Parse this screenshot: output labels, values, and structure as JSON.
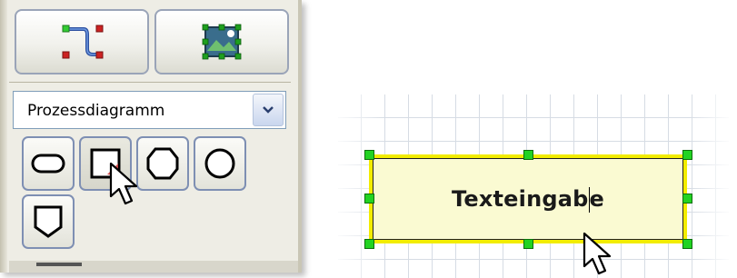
{
  "toolbar": {
    "buttons": [
      {
        "name": "connector-tool",
        "icon": "connector-curve-icon"
      },
      {
        "name": "image-tool",
        "icon": "image-frame-icon"
      }
    ]
  },
  "diagram_type": {
    "selected": "Prozessdiagramm",
    "icon": "chevron-down-icon"
  },
  "shapes": [
    {
      "name": "shape-terminator",
      "icon": "rounded-rectangle-icon"
    },
    {
      "name": "shape-process",
      "icon": "square-icon",
      "active": true
    },
    {
      "name": "shape-preparation",
      "icon": "octagon-icon"
    },
    {
      "name": "shape-connector-circle",
      "icon": "circle-icon"
    },
    {
      "name": "shape-offpage",
      "icon": "pentagon-icon"
    }
  ],
  "canvas": {
    "text_box": {
      "text_before_caret": "Texteingab",
      "text_after_caret": "e"
    }
  },
  "colors": {
    "selection_border": "#f2ec00",
    "box_fill": "#fafad2",
    "handle": "#22d322",
    "button_border": "#7e8fb3"
  }
}
